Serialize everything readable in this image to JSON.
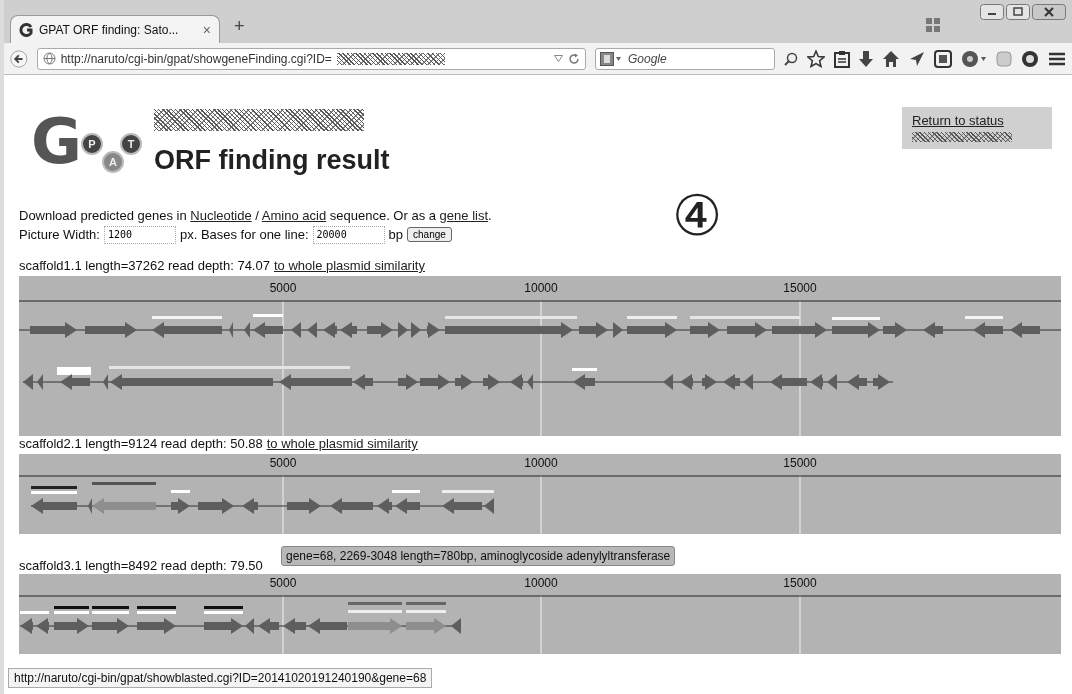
{
  "browser": {
    "tab": {
      "title": "GPAT ORF finding: Sato...",
      "close": "×"
    },
    "new_tab": "+",
    "address": "http://naruto/cgi-bin/gpat/showgeneFinding.cgi?ID=",
    "search": {
      "placeholder": "Google"
    }
  },
  "logo": {
    "letters": [
      "G",
      "P",
      "A",
      "T"
    ]
  },
  "heading": "ORF finding result",
  "return_link": "Return to status",
  "download": [
    {
      "kind": "text",
      "text": "Download predicted genes in "
    },
    {
      "kind": "link",
      "text": "Nucleotide"
    },
    {
      "kind": "text",
      "text": " / "
    },
    {
      "kind": "link",
      "text": "Amino acid"
    },
    {
      "kind": "text",
      "text": " sequence. Or as a "
    },
    {
      "kind": "link",
      "text": "gene list"
    },
    {
      "kind": "text",
      "text": "."
    }
  ],
  "settings": [
    {
      "kind": "label",
      "text": "Picture Width:"
    },
    {
      "kind": "input",
      "value": "1200"
    },
    {
      "kind": "label",
      "text": "px. Bases for one line:"
    },
    {
      "kind": "input",
      "value": "20000"
    },
    {
      "kind": "label",
      "text": "bp"
    },
    {
      "kind": "button",
      "text": "change"
    }
  ],
  "annotation": "④",
  "scaffolds": [
    {
      "info": "scaffold1.1 length=37262 read depth: 74.07",
      "link": "to whole plasmid similarity",
      "ticks": [
        "5000",
        "10000",
        "15000"
      ]
    },
    {
      "info": "scaffold2.1 length=9124 read depth: 50.88",
      "link": "to whole plasmid similarity",
      "ticks": [
        "5000",
        "10000",
        "15000"
      ]
    },
    {
      "info": "scaffold3.1 length=8492 read depth: 79.50",
      "ticks": [
        "5000",
        "10000",
        "15000"
      ]
    }
  ],
  "tooltip": "gene=68, 2269-3048 length=780bp, aminoglycoside adenylyltransferase",
  "status_bar": "http://naruto/cgi-bin/gpat/showblasted.cgi?ID=20141020191240190&gene=68"
}
